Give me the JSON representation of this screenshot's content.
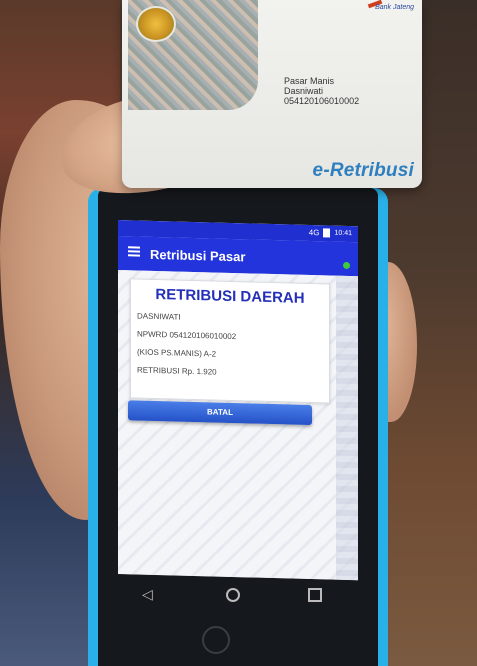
{
  "card": {
    "holder_place": "Pasar Manis",
    "holder_name": "Dasniwati",
    "holder_id": "054120106010002",
    "brand": "e-Retribusi",
    "bank": "Bank Jateng"
  },
  "status_bar": {
    "network": "4G",
    "time": "10:41"
  },
  "app_bar": {
    "title": "Retribusi Pasar"
  },
  "panel": {
    "title": "RETRIBUSI DAERAH",
    "name": "DASNIWATI",
    "npwrd": "NPWRD 054120106010002",
    "kios": "(KIOS PS.MANIS)  A-2",
    "retribusi": "RETRIBUSI Rp. 1.920"
  },
  "actions": {
    "cancel_label": "BATAL"
  },
  "colors": {
    "app_bar": "#2434dc",
    "title_text": "#2530b8",
    "device_case": "#2ab0e8",
    "brand": "#2f7fbf"
  },
  "icons": [
    "menu-icon",
    "online-status-icon",
    "battery-icon",
    "back-icon",
    "home-icon",
    "recent-apps-icon"
  ]
}
